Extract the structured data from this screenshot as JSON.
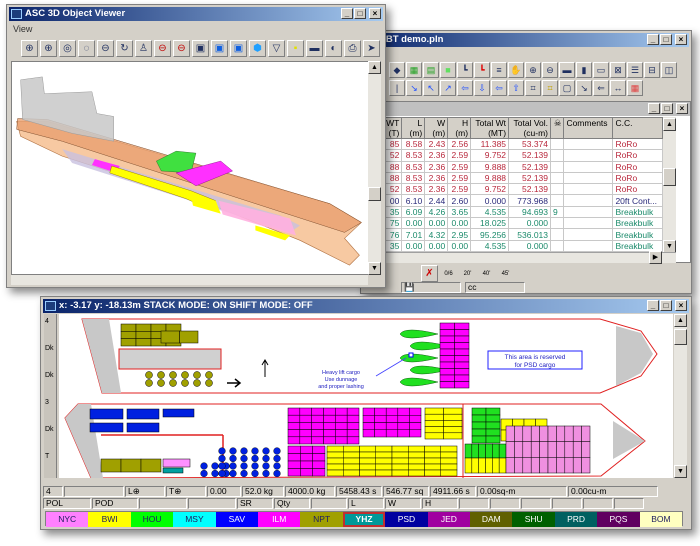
{
  "viewer": {
    "title": "ASC 3D Object Viewer",
    "menu": [
      "View"
    ],
    "toolbar": [
      "zoom-in-icon",
      "zoom-window-icon",
      "zoom-extents-icon",
      "zoom-previous-icon",
      "zoom-out-icon",
      "rotate-icon",
      "walk-icon",
      "orbit-icon",
      "orbit-free-icon",
      "view-front-icon",
      "view-side-icon",
      "view-top-icon",
      "view-iso-icon",
      "view-bottom-icon",
      "light-icon",
      "shade-icon",
      "render-icon",
      "print-icon",
      "pointer-icon"
    ]
  },
  "plan": {
    "title": "CBT demo.pln",
    "toolbar1": [
      "layers-icon",
      "grid-icon",
      "grid-2-icon",
      "fill-icon",
      "stack-icon",
      "stack-red-icon",
      "sort-icon",
      "pan-icon",
      "zoom-in-icon",
      "zoom-out-icon",
      "fit-width-icon",
      "fit-height-icon",
      "row-icon",
      "clear-icon",
      "list-icon",
      "split-h-icon",
      "split-v-icon"
    ],
    "toolbar2": [
      "line-icon",
      "diag-down-icon",
      "diag-up-icon",
      "diag-icon",
      "arrow-left-icon",
      "arrow-down-icon",
      "arrow-left-2-icon",
      "arrow-up-icon",
      "node-icon",
      "node-yellow-icon",
      "frame-icon",
      "measure-icon",
      "back-icon",
      "dimension-icon",
      "calc-icon"
    ],
    "table": {
      "headers": [
        [
          "WT",
          "(T)"
        ],
        [
          "L",
          "(m)"
        ],
        [
          "W",
          "(m)"
        ],
        [
          "H",
          "(m)"
        ],
        [
          "Total Wt",
          "(MT)"
        ],
        [
          "Total Vol.",
          "(cu-m)"
        ],
        [
          "☠",
          ""
        ],
        [
          "Comments",
          ""
        ],
        [
          "C.C.",
          ""
        ]
      ],
      "rows": [
        {
          "cells": [
            "85",
            "8.58",
            "2.43",
            "2.56",
            "11.385",
            "53.374",
            "",
            "",
            "RoRo"
          ],
          "color": "#b8283c"
        },
        {
          "cells": [
            "52",
            "8.53",
            "2.36",
            "2.59",
            "9.752",
            "52.139",
            "",
            "",
            "RoRo"
          ],
          "color": "#b8283c"
        },
        {
          "cells": [
            "88",
            "8.53",
            "2.36",
            "2.59",
            "9.888",
            "52.139",
            "",
            "",
            "RoRo"
          ],
          "color": "#b8283c"
        },
        {
          "cells": [
            "88",
            "8.53",
            "2.36",
            "2.59",
            "9.888",
            "52.139",
            "",
            "",
            "RoRo"
          ],
          "color": "#b8283c"
        },
        {
          "cells": [
            "52",
            "8.53",
            "2.36",
            "2.59",
            "9.752",
            "52.139",
            "",
            "",
            "RoRo"
          ],
          "color": "#b8283c"
        },
        {
          "cells": [
            "00",
            "6.10",
            "2.44",
            "2.60",
            "0.000",
            "773.968",
            "",
            "",
            "20ft Cont..."
          ],
          "color": "#2a2a7a"
        },
        {
          "cells": [
            "35",
            "6.09",
            "4.26",
            "3.65",
            "4.535",
            "94.693",
            "9",
            "",
            "Breakbulk"
          ],
          "color": "#1a8a6a"
        },
        {
          "cells": [
            "75",
            "0.00",
            "0.00",
            "0.00",
            "18.025",
            "0.000",
            "",
            "",
            "Breakbulk"
          ],
          "color": "#1a8a6a"
        },
        {
          "cells": [
            "76",
            "7.01",
            "4.32",
            "2.95",
            "95.256",
            "536.013",
            "",
            "",
            "Breakbulk"
          ],
          "color": "#1a8a6a"
        },
        {
          "cells": [
            "35",
            "0.00",
            "0.00",
            "0.00",
            "4.535",
            "0.000",
            "",
            "",
            "Breakbulk"
          ],
          "color": "#1a8a6a"
        }
      ]
    },
    "filters": [
      "0/6",
      "20'",
      "40'",
      "45'"
    ],
    "status": [
      "",
      "cc"
    ]
  },
  "deck": {
    "title": "x: -3.17   y: -18.13m STACK MODE: ON   SHIFT MODE: OFF",
    "note_heavy": [
      "Heavy lift cargo",
      "Use dunnage",
      "and proper lashing"
    ],
    "note_reserved": [
      "This area is reserved",
      "for PSD cargo"
    ],
    "ruler": [
      "4",
      "Dk",
      "Dk",
      "3",
      "Dk",
      "T"
    ],
    "status1": [
      "4",
      "",
      "L⊕",
      "T⊕",
      "0.00",
      "52.0 kg",
      "4000.0 kg",
      "5458.43 s",
      "546.77 sq",
      "4911.66 s",
      "0.00sq-m",
      "0.00cu-m"
    ],
    "status2": [
      "POL",
      "POD",
      "",
      "",
      "SR",
      "Qty",
      "",
      "L",
      "W",
      "H",
      "",
      "",
      "",
      "",
      "",
      ""
    ],
    "ports": [
      {
        "code": "NYC",
        "color": "#ff80ff",
        "text": "#202060"
      },
      {
        "code": "BWI",
        "color": "#ffff00",
        "text": "#202060"
      },
      {
        "code": "HOU",
        "color": "#00ff00",
        "text": "#202060"
      },
      {
        "code": "MSY",
        "color": "#00ffff",
        "text": "#202060"
      },
      {
        "code": "SAV",
        "color": "#0000ff",
        "text": "#ffffff"
      },
      {
        "code": "ILM",
        "color": "#ff00ff",
        "text": "#ffffff"
      },
      {
        "code": "NPT",
        "color": "#a0a000",
        "text": "#202060"
      },
      {
        "code": "YHZ",
        "color": "#009999",
        "text": "#ffffff",
        "selected": true
      },
      {
        "code": "PSD",
        "color": "#0000a0",
        "text": "#ffffff"
      },
      {
        "code": "JED",
        "color": "#a000a0",
        "text": "#ffffff"
      },
      {
        "code": "DAM",
        "color": "#606000",
        "text": "#ffffff"
      },
      {
        "code": "SHU",
        "color": "#006000",
        "text": "#ffffff"
      },
      {
        "code": "PRD",
        "color": "#006060",
        "text": "#ffffff"
      },
      {
        "code": "PQS",
        "color": "#600060",
        "text": "#ffffff"
      },
      {
        "code": "BOM",
        "color": "#ffffc0",
        "text": "#202060"
      }
    ]
  }
}
